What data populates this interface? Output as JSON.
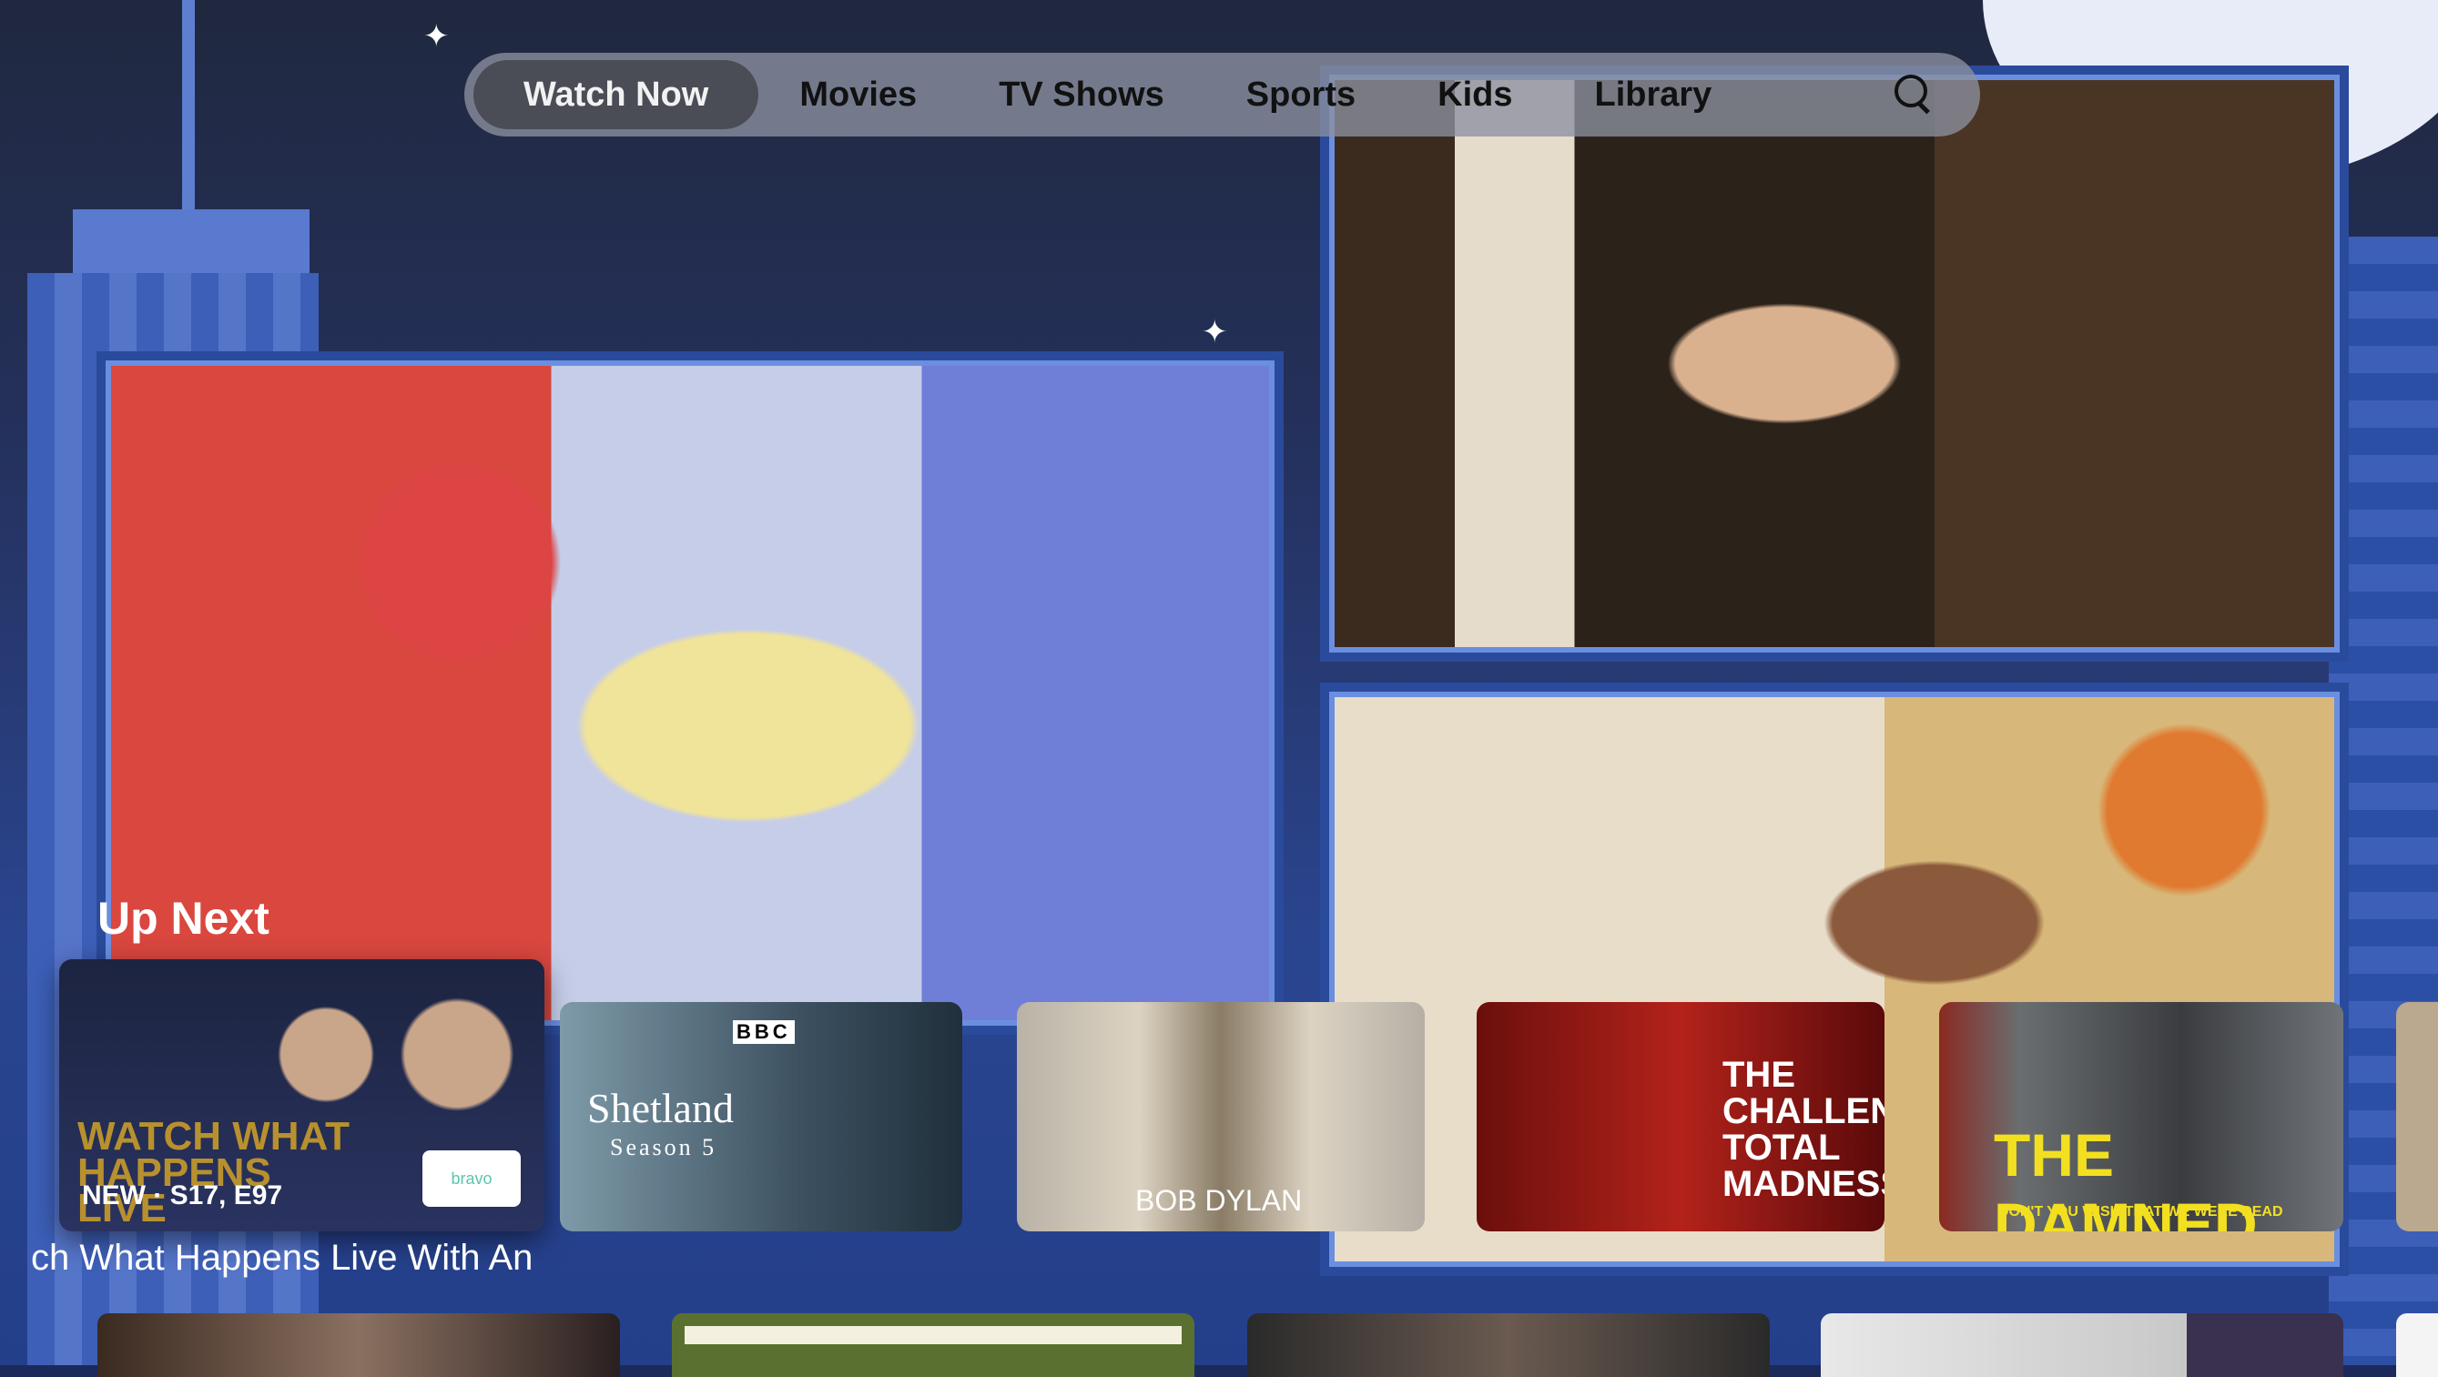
{
  "nav": {
    "tabs": [
      {
        "label": "Watch Now",
        "active": true
      },
      {
        "label": "Movies"
      },
      {
        "label": "TV Shows"
      },
      {
        "label": "Sports"
      },
      {
        "label": "Kids"
      },
      {
        "label": "Library"
      }
    ],
    "search_icon": "search-icon"
  },
  "up_next": {
    "title": "Up Next",
    "items": [
      {
        "title": "Watch What Happens Live With Andy Cohen",
        "artwork_text": "WATCH WHAT HAPPENS LIVE",
        "badge": "NEW · S17, E97",
        "network": "bravo",
        "focused": true,
        "visible_title": "ch What Happens Live With An"
      },
      {
        "artwork_text": "Shetland",
        "artwork_sub": "Season 5",
        "network": "BBC"
      },
      {
        "artwork_text": "BOB DYLAN"
      },
      {
        "artwork_text": "THE CHALLENGE TOTAL MADNESS"
      },
      {
        "artwork_text": "THE DAMNED",
        "artwork_sub": "DON'T YOU WISH THAT WE WERE DEAD"
      }
    ]
  },
  "colors": {
    "nav_bg": "#8c91a0",
    "active_tab": "#4a4d55",
    "background": "#24305a"
  }
}
